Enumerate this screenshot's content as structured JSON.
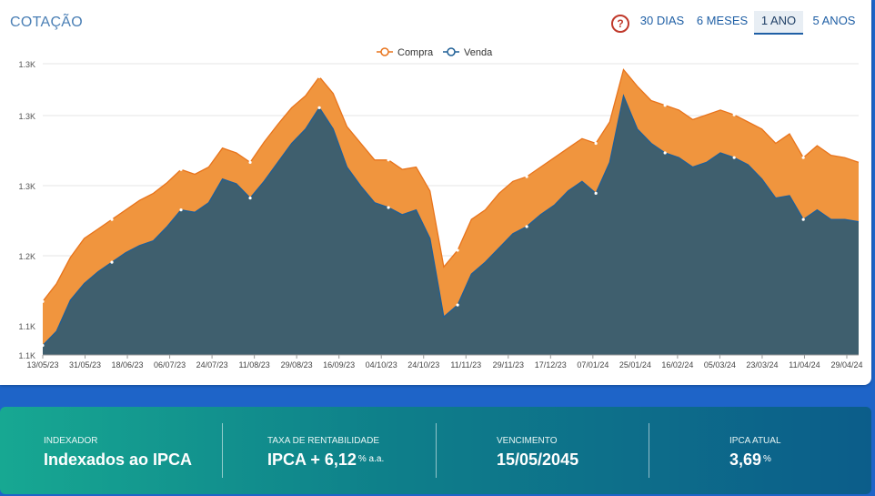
{
  "header": {
    "title": "COTAÇÃO",
    "ranges": [
      "30 DIAS",
      "6 MESES",
      "1 ANO",
      "5 ANOS"
    ],
    "active_range": "1 ANO"
  },
  "colors": {
    "compra": "#f0953e",
    "compra_line": "#e8741c",
    "venda": "#3f5f6e",
    "venda_line": "#1f5f96"
  },
  "chart_data": {
    "type": "area",
    "legend_position": "top-center",
    "y_tick_labels": [
      "1.1K",
      "1.1K",
      "1.2K",
      "1.3K",
      "1.3K",
      "1.3K"
    ],
    "x_tick_labels": [
      "13/05/23",
      "31/05/23",
      "18/06/23",
      "06/07/23",
      "24/07/23",
      "11/08/23",
      "29/08/23",
      "16/09/23",
      "04/10/23",
      "24/10/23",
      "11/11/23",
      "29/11/23",
      "17/12/23",
      "07/01/24",
      "25/01/24",
      "16/02/24",
      "05/03/24",
      "23/03/24",
      "11/04/24",
      "29/04/24"
    ],
    "ylim": [
      1100,
      1345
    ],
    "series": [
      {
        "name": "Compra",
        "values": [
          1145,
          1160,
          1182,
          1198,
          1206,
          1214,
          1222,
          1230,
          1236,
          1245,
          1256,
          1252,
          1258,
          1274,
          1270,
          1262,
          1279,
          1294,
          1308,
          1318,
          1334,
          1320,
          1292,
          1278,
          1264,
          1264,
          1256,
          1258,
          1238,
          1174,
          1188,
          1214,
          1222,
          1236,
          1246,
          1250,
          1258,
          1266,
          1274,
          1282,
          1278,
          1296,
          1340,
          1326,
          1314,
          1310,
          1306,
          1298,
          1302,
          1306,
          1302,
          1296,
          1290,
          1278,
          1286,
          1266,
          1276,
          1268,
          1266,
          1262
        ]
      },
      {
        "name": "Venda",
        "values": [
          1108,
          1120,
          1146,
          1160,
          1170,
          1178,
          1186,
          1192,
          1196,
          1208,
          1222,
          1220,
          1228,
          1248,
          1244,
          1232,
          1246,
          1262,
          1278,
          1290,
          1308,
          1290,
          1258,
          1242,
          1228,
          1224,
          1218,
          1222,
          1198,
          1132,
          1142,
          1168,
          1178,
          1190,
          1202,
          1208,
          1218,
          1226,
          1238,
          1246,
          1236,
          1262,
          1318,
          1290,
          1278,
          1270,
          1266,
          1258,
          1262,
          1270,
          1266,
          1260,
          1248,
          1232,
          1234,
          1214,
          1222,
          1214,
          1214,
          1212
        ]
      }
    ]
  },
  "info": {
    "indexador": {
      "label": "INDEXADOR",
      "value": "Indexados ao IPCA"
    },
    "taxa": {
      "label": "TAXA DE RENTABILIDADE",
      "value": "IPCA + 6,12",
      "unit": "% a.a."
    },
    "vencimento": {
      "label": "VENCIMENTO",
      "value": "15/05/2045"
    },
    "ipca": {
      "label": "IPCA ATUAL",
      "value": "3,69",
      "unit": "%"
    }
  }
}
